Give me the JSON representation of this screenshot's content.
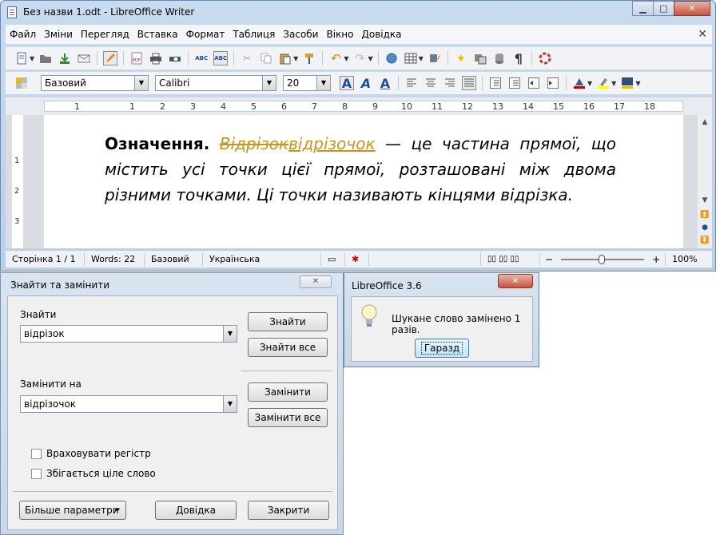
{
  "window": {
    "title": "Без назви 1.odt - LibreOffice Writer",
    "minimize": "▭",
    "maximize": "□",
    "close": "✕"
  },
  "menu": [
    "Файл",
    "Зміни",
    "Перегляд",
    "Вставка",
    "Формат",
    "Таблиця",
    "Засоби",
    "Вікно",
    "Довідка"
  ],
  "menu_close": "✕",
  "formatting": {
    "style": "Базовий",
    "font": "Calibri",
    "size": "20"
  },
  "ruler": {
    "numbers": [
      "1",
      "1",
      "2",
      "3",
      "4",
      "5",
      "6",
      "7",
      "8",
      "9",
      "10",
      "11",
      "12",
      "13",
      "14",
      "15",
      "16",
      "17",
      "18"
    ]
  },
  "vruler": [
    "1",
    "2",
    "3"
  ],
  "document": {
    "bold_term": "Означення.",
    "deleted_word": "Відрізок",
    "inserted_word": "відрізочок",
    "rest": " — це частина прямої, що містить усі точки цієї прямої, розташовані між двома різними точками. Ці точки називають кінцями відрізка."
  },
  "status": {
    "page": "Сторінка 1 / 1",
    "words": "Words: 22",
    "style": "Базовий",
    "language": "Українська",
    "zoom": "100%",
    "zoom_minus": "−",
    "zoom_plus": "+"
  },
  "find_dialog": {
    "title": "Знайти та замінити",
    "close": "✕",
    "find_label": "Знайти",
    "find_value": "відрізок",
    "replace_label": "Замінити на",
    "replace_value": "відрізочок",
    "find_button": "Знайти",
    "find_all_button": "Знайти все",
    "replace_button": "Замінити",
    "replace_all_button": "Замінити все",
    "match_case": "Враховувати регістр",
    "whole_word": "Збігається ціле слово",
    "more_options": "Більше параметри",
    "help_button": "Довідка",
    "close_button": "Закрити"
  },
  "message_box": {
    "title": "LibreOffice 3.6",
    "close": "✕",
    "text": "Шукане слово замінено 1 разів.",
    "ok": "Гаразд"
  },
  "icons": {
    "find_dialog_dropdown": "▼",
    "more_options_arrow": "⏷"
  }
}
